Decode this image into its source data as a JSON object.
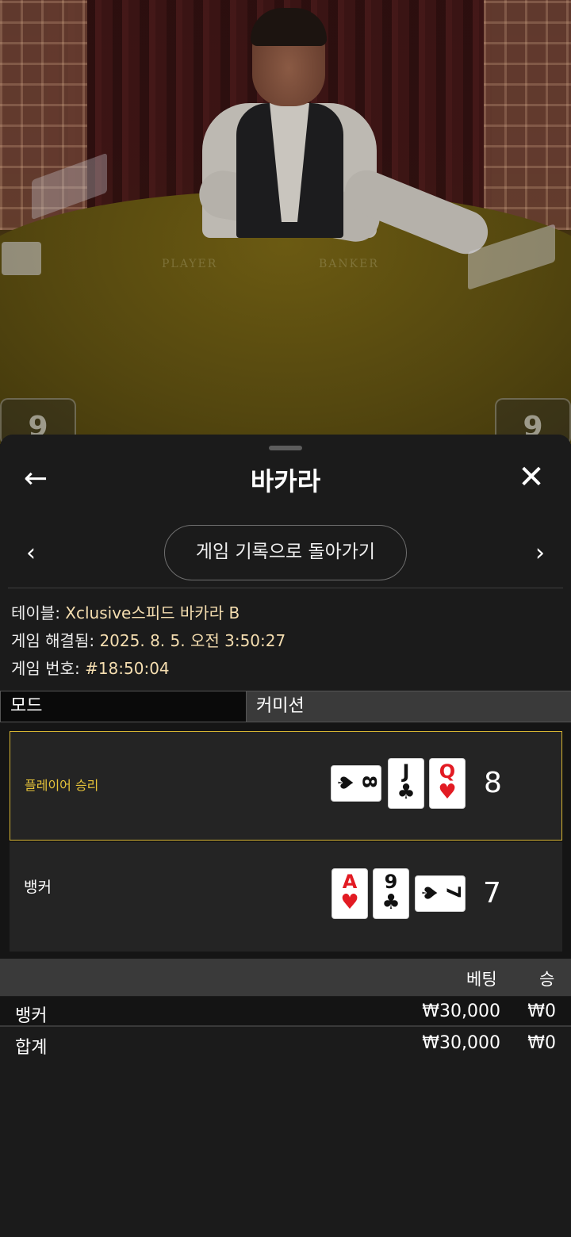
{
  "video": {
    "felt_player": "PLAYER",
    "felt_banker": "BANKER",
    "score_left": "9",
    "score_right": "9"
  },
  "header": {
    "back_icon": "←",
    "title": "바카라",
    "close_icon": "✕"
  },
  "nav": {
    "prev_icon": "‹",
    "next_icon": "›",
    "back_to_history": "게임 기록으로 돌아가기"
  },
  "info": {
    "table_label": "테이블: ",
    "table_value": "Xclusive스피드 바카라 B",
    "resolved_label": "게임 해결됨: ",
    "resolved_value": "2025. 8. 5. 오전 3:50:27",
    "game_no_label": "게임 번호: ",
    "game_no_value": "#18:50:04"
  },
  "tabs": {
    "mode": "모드",
    "commission": "커미션"
  },
  "hands": {
    "player": {
      "label": "플레이어 승리",
      "score": "8",
      "cards": [
        {
          "rank": "8",
          "suit": "♠",
          "color": "#111111",
          "orientation": "sideways"
        },
        {
          "rank": "J",
          "suit": "♣",
          "color": "#111111",
          "orientation": "upright"
        },
        {
          "rank": "Q",
          "suit": "♥",
          "color": "#e21b23",
          "orientation": "upright"
        }
      ]
    },
    "banker": {
      "label": "뱅커",
      "score": "7",
      "cards": [
        {
          "rank": "A",
          "suit": "♥",
          "color": "#e21b23",
          "orientation": "upright"
        },
        {
          "rank": "9",
          "suit": "♣",
          "color": "#111111",
          "orientation": "upright"
        },
        {
          "rank": "7",
          "suit": "♠",
          "color": "#111111",
          "orientation": "sideways"
        }
      ]
    }
  },
  "bets": {
    "col_bet": "베팅",
    "col_win": "승",
    "rows": [
      {
        "name": "뱅커",
        "bet": "₩30,000",
        "win": "₩0"
      }
    ],
    "total": {
      "name": "합계",
      "bet": "₩30,000",
      "win": "₩0"
    }
  },
  "colors": {
    "winner_border": "#d6b432",
    "winner_text": "#e7c43a",
    "info_value": "#f5deb0",
    "card_red": "#e21b23"
  }
}
